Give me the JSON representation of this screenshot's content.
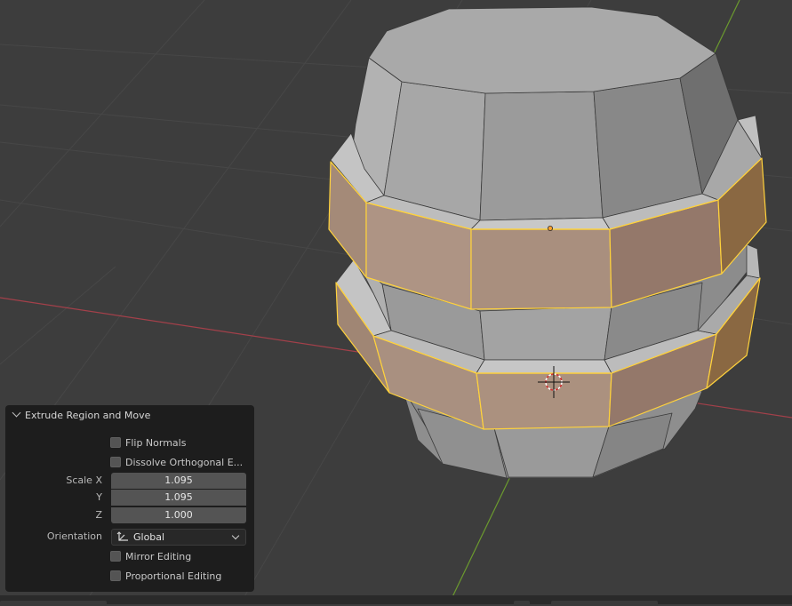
{
  "operator_panel": {
    "title": "Extrude Region and Move",
    "flip_normals": {
      "label": "Flip Normals",
      "checked": false
    },
    "dissolve_orthogonal": {
      "label": "Dissolve Orthogonal E...",
      "checked": false
    },
    "scale": {
      "x_label": "Scale X",
      "x_value": "1.095",
      "y_label": "Y",
      "y_value": "1.095",
      "z_label": "Z",
      "z_value": "1.000"
    },
    "orientation": {
      "label": "Orientation",
      "value": "Global",
      "icon": "orientation-gizmo-icon"
    },
    "mirror_editing": {
      "label": "Mirror Editing",
      "checked": false
    },
    "proportional_editing": {
      "label": "Proportional Editing",
      "checked": false
    }
  },
  "colors": {
    "viewport_bg": "#3d3d3d",
    "grid_line": "#474747",
    "x_axis": "#a3404a",
    "y_axis": "#6b9a2e",
    "selected_face": "#a58f80",
    "selected_edge": "#ffd23c",
    "mesh_gray": "#9a9a9a",
    "panel_bg": "#1d1d1d"
  }
}
